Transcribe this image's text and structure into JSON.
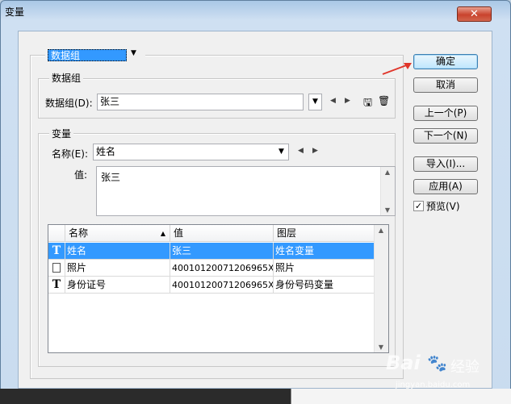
{
  "window": {
    "title": "变量",
    "close_glyph": "✕"
  },
  "top": {
    "dataset_select": "数据组"
  },
  "dataset_group": {
    "label": "数据组",
    "field_label": "数据组(D):",
    "value": "张三"
  },
  "variable_group": {
    "label": "变量",
    "name_label": "名称(E):",
    "name_value": "姓名",
    "value_label": "值:",
    "value_text": "张三"
  },
  "table": {
    "headers": [
      "名称",
      "值",
      "图层"
    ],
    "rows": [
      {
        "type": "T",
        "name": "姓名",
        "value": "张三",
        "layer": "姓名变量"
      },
      {
        "type": "img",
        "name": "照片",
        "value": "40010120071206965X....",
        "layer": "照片"
      },
      {
        "type": "T",
        "name": "身份证号",
        "value": "40010120071206965X",
        "layer": "身份号码变量"
      }
    ]
  },
  "buttons": {
    "ok": "确定",
    "cancel": "取消",
    "prev": "上一个(P)",
    "next": "下一个(N)",
    "import": "导入(I)...",
    "apply": "应用(A)",
    "preview": "预览(V)"
  },
  "watermark": {
    "brand": "Bai",
    "site": "jingyan.baidu.com",
    "cn": "经验"
  },
  "colors": {
    "selection": "#3399ff",
    "arrow": "#e0362b"
  }
}
